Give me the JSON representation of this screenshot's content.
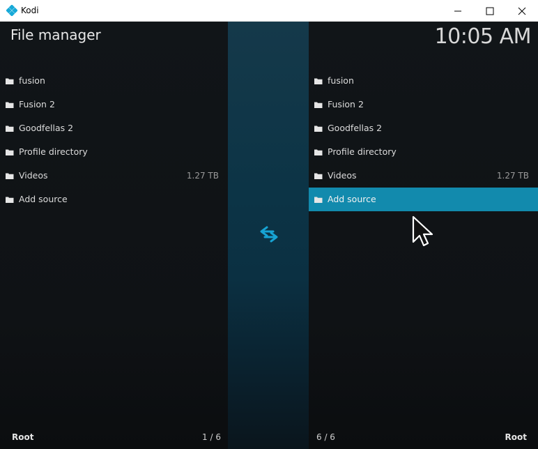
{
  "window": {
    "title": "Kodi",
    "controls": [
      "minimize",
      "maximize",
      "close"
    ]
  },
  "app": {
    "title": "File manager",
    "clock": "10:05 AM"
  },
  "left_pane": {
    "items": [
      {
        "label": "fusion",
        "size": ""
      },
      {
        "label": "Fusion 2",
        "size": ""
      },
      {
        "label": "Goodfellas 2",
        "size": ""
      },
      {
        "label": "Profile directory",
        "size": ""
      },
      {
        "label": "Videos",
        "size": "1.27 TB"
      },
      {
        "label": "Add source",
        "size": ""
      }
    ],
    "path": "Root",
    "counter": "1 / 6"
  },
  "right_pane": {
    "items": [
      {
        "label": "fusion",
        "size": ""
      },
      {
        "label": "Fusion 2",
        "size": ""
      },
      {
        "label": "Goodfellas 2",
        "size": ""
      },
      {
        "label": "Profile directory",
        "size": ""
      },
      {
        "label": "Videos",
        "size": "1.27 TB"
      },
      {
        "label": "Add source",
        "size": "",
        "selected": true
      }
    ],
    "path": "Root",
    "counter": "6 / 6"
  },
  "icons": {
    "item": "folder-icon",
    "center": "swap-arrows-icon",
    "cursor": "mouse-pointer-icon"
  },
  "colors": {
    "accent": "#128aad",
    "center_panel": "#0c3446",
    "background": "#101316"
  }
}
